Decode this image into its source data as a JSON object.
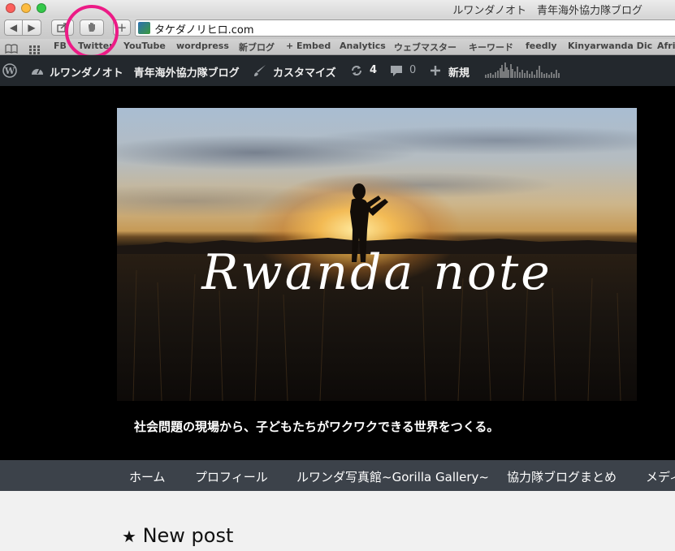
{
  "window": {
    "title": "ルワンダノオト　青年海外協力隊ブログ",
    "traffic_lights": [
      "#fc605c",
      "#fdbc40",
      "#34c84a"
    ]
  },
  "toolbar": {
    "back_icon": "◀",
    "forward_icon": "▶",
    "share_icon": "share-icon",
    "hand_icon": "hand-icon",
    "add_icon": "+",
    "url": "タケダノリヒロ.com"
  },
  "bookmarks": {
    "items": [
      "FB",
      "Twitter",
      "YouTube",
      "wordpress",
      "新ブログ",
      "+ Embed",
      "Analytics",
      "ウェブマスター",
      "キーワード",
      "feedly",
      "Kinyarwanda Dic",
      "Afri"
    ]
  },
  "admin_bar": {
    "site_name": "ルワンダノオト　青年海外協力隊ブログ",
    "customize": "カスタマイズ",
    "updates_count": "4",
    "comments_count": "0",
    "new_label": "新規"
  },
  "site": {
    "hero_title": "Rwanda note",
    "tagline": "社会問題の現場から、子どもたちがワクワクできる世界をつくる。"
  },
  "nav": {
    "items": [
      "ホーム",
      "プロフィール",
      "ルワンダ写真館~Gorilla Gallery~",
      "協力隊ブログまとめ",
      "メディ"
    ]
  },
  "content": {
    "section_title": "New post",
    "section_icon": "★"
  },
  "colors": {
    "highlight": "#ec1b86",
    "admin_bar": "#23282d",
    "nav": "#3c424a"
  }
}
